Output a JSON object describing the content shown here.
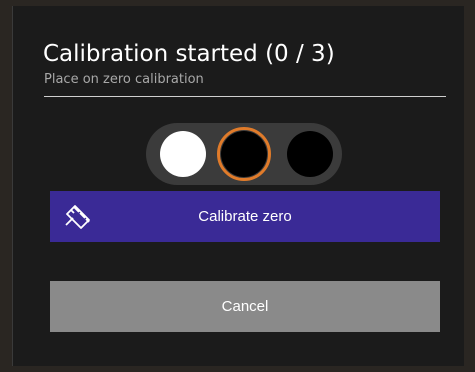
{
  "dialog": {
    "title": "Calibration started (0 / 3)",
    "subtitle": "Place on zero calibration"
  },
  "progress": {
    "completed": 0,
    "total": 3,
    "current_step": 2,
    "accent_color": "#e07b2a"
  },
  "buttons": {
    "calibrate_label": "Calibrate zero",
    "calibrate_icon": "ruler-icon",
    "calibrate_color": "#3a2a96",
    "cancel_label": "Cancel",
    "cancel_color": "#8a8a8a"
  }
}
